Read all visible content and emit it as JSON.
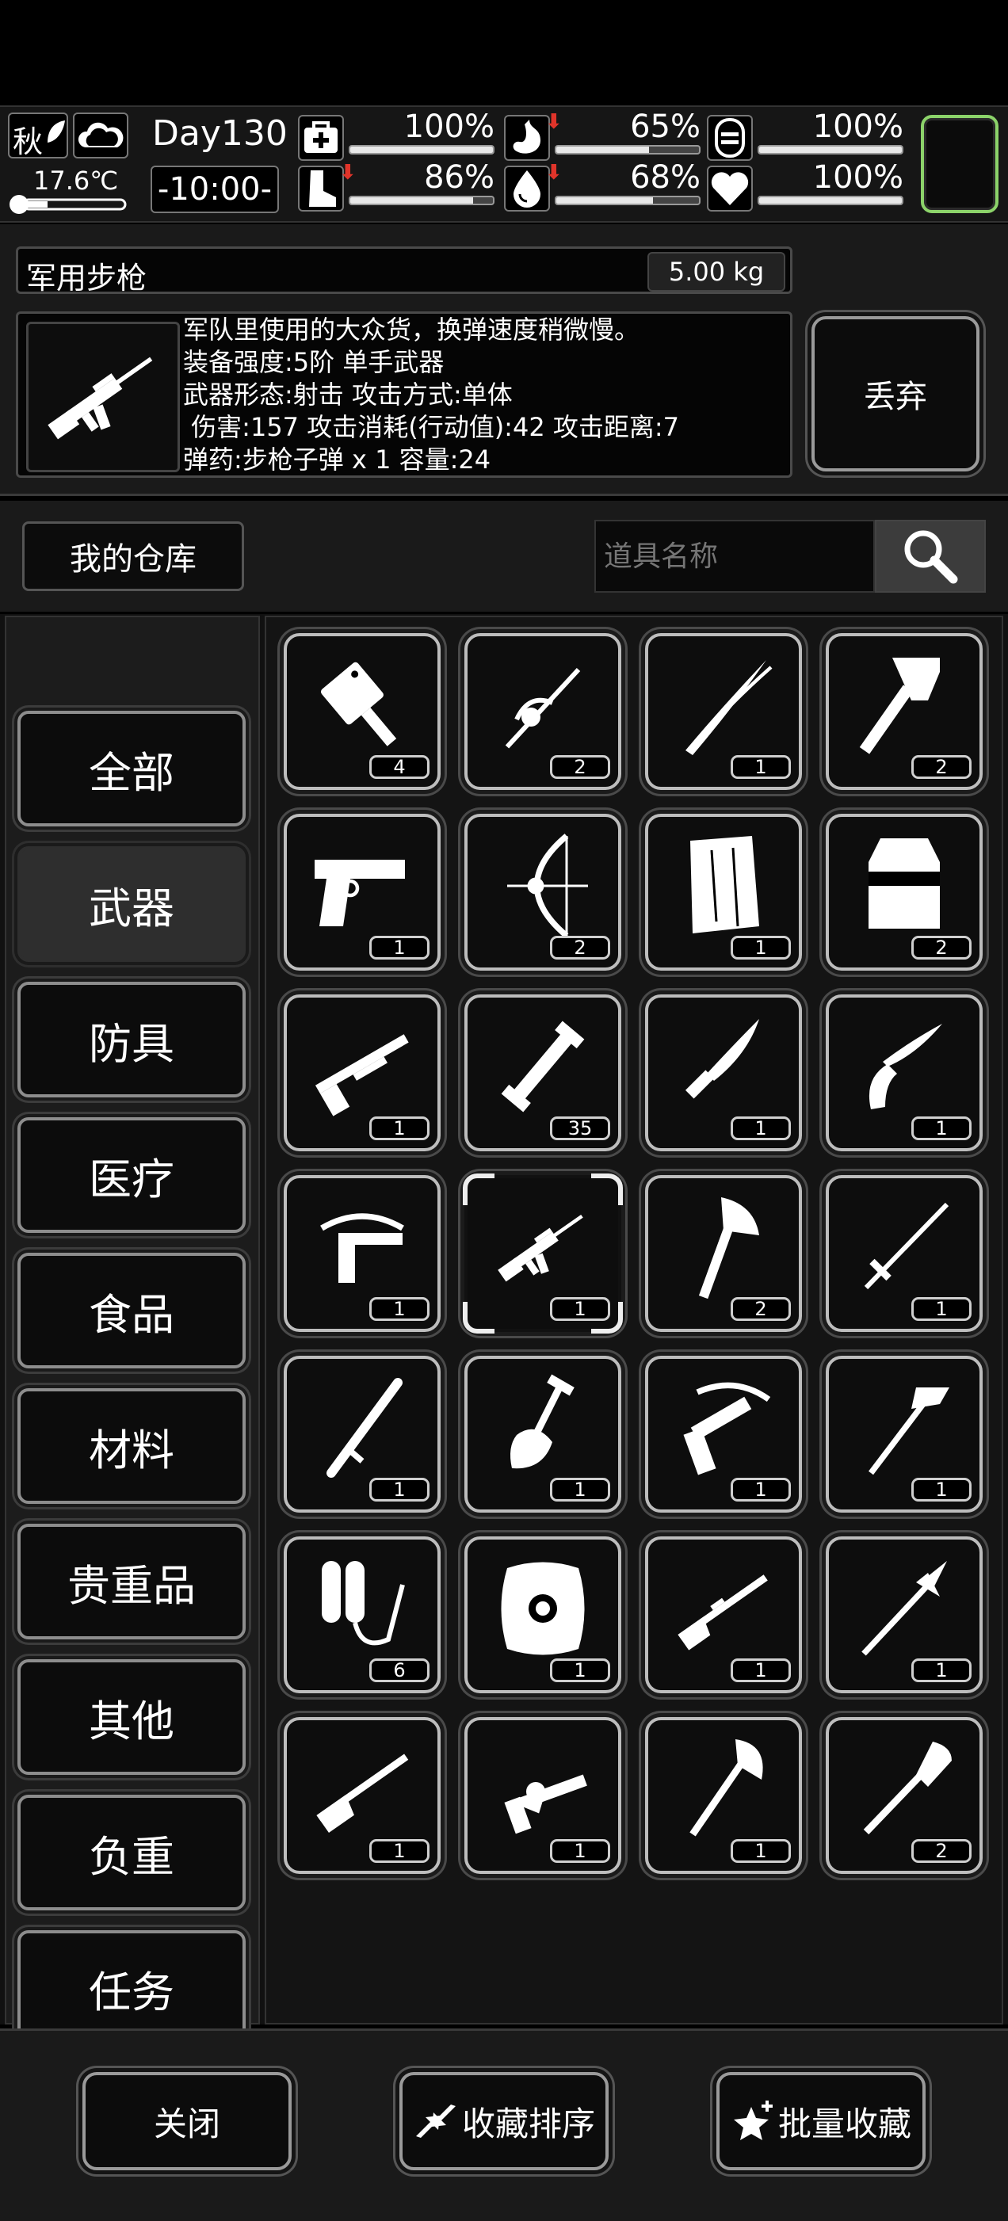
{
  "status": {
    "season": "秋",
    "temperature": "17.6℃",
    "day": "Day130",
    "time": "-10:00-",
    "stats": [
      {
        "key": "health",
        "icon": "first-aid-kit-icon",
        "value_label": "100%",
        "level": 1.0,
        "warning": false
      },
      {
        "key": "hunger",
        "icon": "stomach-icon",
        "value_label": "65%",
        "level": 0.65,
        "warning": true
      },
      {
        "key": "mood",
        "icon": "mood-face-icon",
        "value_label": "100%",
        "level": 1.0,
        "warning": false
      },
      {
        "key": "stamina",
        "icon": "boot-icon",
        "value_label": "86%",
        "level": 0.86,
        "warning": true
      },
      {
        "key": "thirst",
        "icon": "water-drop-icon",
        "value_label": "68%",
        "level": 0.68,
        "warning": true
      },
      {
        "key": "heart",
        "icon": "heart-icon",
        "value_label": "100%",
        "level": 1.0,
        "warning": false
      }
    ]
  },
  "item": {
    "name": "军用步枪",
    "weight": "5.00 kg",
    "description_lines": [
      "军队里使用的大众货，换弹速度稍微慢。",
      "装备强度:5阶 单手武器",
      "武器形态:射击 攻击方式:单体",
      " 伤害:157 攻击消耗(行动值):42 攻击距离:7",
      "弹药:步枪子弹 x 1 容量:24"
    ],
    "discard_label": "丢弃"
  },
  "warehouse": {
    "title": "我的仓库",
    "search_placeholder": "道具名称"
  },
  "categories": [
    {
      "label": "全部",
      "selected": false
    },
    {
      "label": "武器",
      "selected": true
    },
    {
      "label": "防具",
      "selected": false
    },
    {
      "label": "医疗",
      "selected": false
    },
    {
      "label": "食品",
      "selected": false
    },
    {
      "label": "材料",
      "selected": false
    },
    {
      "label": "贵重品",
      "selected": false
    },
    {
      "label": "其他",
      "selected": false
    },
    {
      "label": "负重",
      "selected": false
    },
    {
      "label": "任务",
      "selected": false
    }
  ],
  "items": [
    {
      "icon": "cleaver-icon",
      "count": "4"
    },
    {
      "icon": "rapier-icon",
      "count": "2"
    },
    {
      "icon": "katana-icon",
      "count": "1"
    },
    {
      "icon": "tomahawk-icon",
      "count": "2"
    },
    {
      "icon": "pistol-icon",
      "count": "1"
    },
    {
      "icon": "compound-bow-icon",
      "count": "2"
    },
    {
      "icon": "wooden-board-icon",
      "count": "1"
    },
    {
      "icon": "riot-shield-icon",
      "count": "2"
    },
    {
      "icon": "shotgun-icon",
      "count": "1"
    },
    {
      "icon": "pipe-icon",
      "count": "35"
    },
    {
      "icon": "combat-knife-icon",
      "count": "1"
    },
    {
      "icon": "folding-knife-icon",
      "count": "1"
    },
    {
      "icon": "crossbow-pistol-icon",
      "count": "1"
    },
    {
      "icon": "assault-rifle-icon",
      "count": "1",
      "selected": true
    },
    {
      "icon": "axe-icon",
      "count": "2"
    },
    {
      "icon": "sword-icon",
      "count": "1"
    },
    {
      "icon": "baton-icon",
      "count": "1"
    },
    {
      "icon": "shovel-icon",
      "count": "1"
    },
    {
      "icon": "crossbow-icon",
      "count": "1"
    },
    {
      "icon": "fire-axe-icon",
      "count": "1"
    },
    {
      "icon": "flamethrower-icon",
      "count": "6"
    },
    {
      "icon": "round-shield-icon",
      "count": "1"
    },
    {
      "icon": "bolt-rifle-icon",
      "count": "1"
    },
    {
      "icon": "spear-icon",
      "count": "1"
    },
    {
      "icon": "hunting-rifle-icon",
      "count": "1"
    },
    {
      "icon": "revolver-icon",
      "count": "1"
    },
    {
      "icon": "battle-axe-icon",
      "count": "1"
    },
    {
      "icon": "spade-icon",
      "count": "2"
    }
  ],
  "bottom": {
    "close_label": "关闭",
    "sort_label": "收藏排序",
    "batch_label": "批量收藏"
  }
}
